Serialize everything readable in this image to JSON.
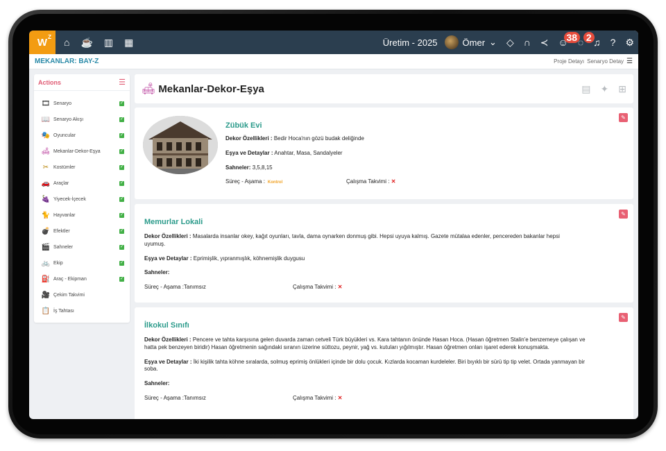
{
  "topbar": {
    "logo": "W",
    "logo_sup": "Z",
    "project": "Üretim - 2025",
    "user_name": "Ömer",
    "badge_emoji": "38",
    "badge_chat": "2"
  },
  "crumbbar": {
    "title": "MEKANLAR: BAY-Z",
    "link1": "Proje Detayı",
    "link2": "Senaryo Detay"
  },
  "sidebar": {
    "title": "Actions",
    "items": [
      {
        "label": "Senaryo",
        "icon": "film-icon",
        "glyph": "🎞",
        "color": "#222"
      },
      {
        "label": "Senaryo Akışı",
        "icon": "book-icon",
        "glyph": "📖",
        "color": "#999"
      },
      {
        "label": "Oyuncular",
        "icon": "masks-icon",
        "glyph": "🎭",
        "color": "#222"
      },
      {
        "label": "Mekanlar-Dekor-Eşya",
        "icon": "sofa-icon",
        "glyph": "🛋",
        "color": "#c04fa5"
      },
      {
        "label": "Kostümler",
        "icon": "scissors-icon",
        "glyph": "✂",
        "color": "#b8860b"
      },
      {
        "label": "Araçlar",
        "icon": "car-icon",
        "glyph": "🚗",
        "color": "#2b6cc4"
      },
      {
        "label": "Yiyecek-İçecek",
        "icon": "food-icon",
        "glyph": "🍇",
        "color": "#8e44ad"
      },
      {
        "label": "Hayvanlar",
        "icon": "cat-icon",
        "glyph": "🐈",
        "color": "#e67e22"
      },
      {
        "label": "Efektler",
        "icon": "bomb-icon",
        "glyph": "💣",
        "color": "#c0392b"
      },
      {
        "label": "Sahneler",
        "icon": "clapper-icon",
        "glyph": "🎬",
        "color": "#f39c12"
      },
      {
        "label": "Ekip",
        "icon": "bike-icon",
        "glyph": "🚲",
        "color": "#2b6cc4"
      },
      {
        "label": "Araç - Ekipman",
        "icon": "fuel-icon",
        "glyph": "⛽",
        "color": "#222"
      },
      {
        "label": "Çekim Takvimi",
        "icon": "camera-icon",
        "glyph": "🎥",
        "color": "#333"
      },
      {
        "label": "İş Tahtası",
        "icon": "clipboard-icon",
        "glyph": "📋",
        "color": "#1aa0d0"
      }
    ]
  },
  "page": {
    "title": "Mekanlar-Dekor-Eşya"
  },
  "labels": {
    "dekor": "Dekor Özellikleri :",
    "esya": "Eşya ve Detaylar :",
    "sahneler": "Sahneler:",
    "surec": "Süreç - Aşama :",
    "takvim": "Çalışma Takvimi :",
    "x": "✕"
  },
  "places": [
    {
      "name": "Zübük Evi",
      "dekor": "Bedir Hoca'nın gözü budak deliğinde",
      "esya": "Anahtar, Masa, Sandalyeler",
      "sahneler": "3,5,8,15",
      "asama": "Kontrol"
    },
    {
      "name": "Memurlar Lokali",
      "dekor": "Masalarda insanlar okey, kağıt oyunları, tavla, dama oynarken donmuş gibi. Hepsi uyuya kalmış. Gazete mütalaa edenler, pencereden bakanlar hepsi uyumuş.",
      "esya": "Eprimişlik, yıpranmışlık, köhnemişlik duygusu",
      "sahneler": "",
      "asama": "Tanımsız"
    },
    {
      "name": "İlkokul Sınıfı",
      "dekor": "Pencere ve tahta karşısına gelen duvarda zaman cetveli Türk büyükleri vs. Kara tahtanın önünde Hasan Hoca. (Hasan öğretmen Stalin'e benzemeye çalışan ve hatta pek benzeyen biridir) Hasan öğretmenin sağındaki sıranın üzerine süttozu, peynir, yağ vs. kutuları yığılmıştır. Hasan öğretmen onları işaret ederek konuşmakta.",
      "esya": "İki kişilik tahta köhne sıralarda, solmuş eprimiş önlükleri içinde bir dolu çocuk. Kızlarda kocaman kurdeleler. Biri bıyıklı bir sürü tip tip velet. Ortada yanmayan bir soba.",
      "sahneler": "",
      "asama": "Tanımsız"
    }
  ]
}
